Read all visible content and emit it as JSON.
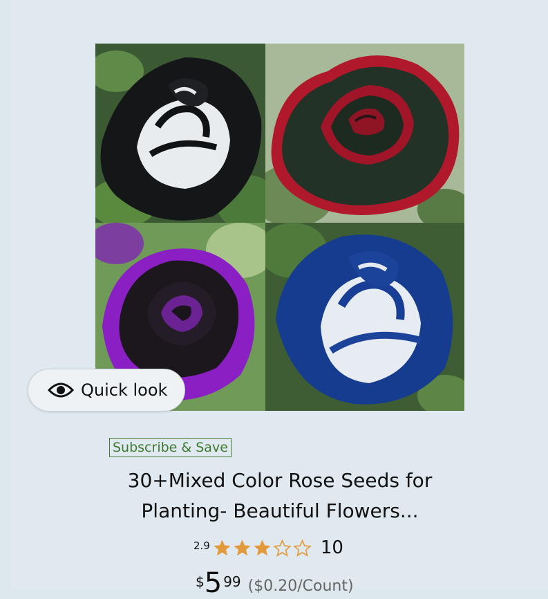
{
  "product": {
    "image_alt": "Four roses: black and white, red and black, purple and black, blue and white",
    "quick_look_label": "Quick look",
    "subscribe_badge": "Subscribe & Save",
    "title_line1": "30+Mixed Color Rose Seeds for",
    "title_line2": "Planting- Beautiful Flowers...",
    "rating": {
      "value": "2.9",
      "stars_filled": 3,
      "stars_total": 5,
      "count": "10"
    },
    "price": {
      "symbol": "$",
      "whole": "5",
      "fraction": "99",
      "unit_price": "($0.20/Count)"
    }
  },
  "colors": {
    "star": "#e39a3b",
    "badge": "#3f7a30",
    "background": "#dfe9ef"
  }
}
